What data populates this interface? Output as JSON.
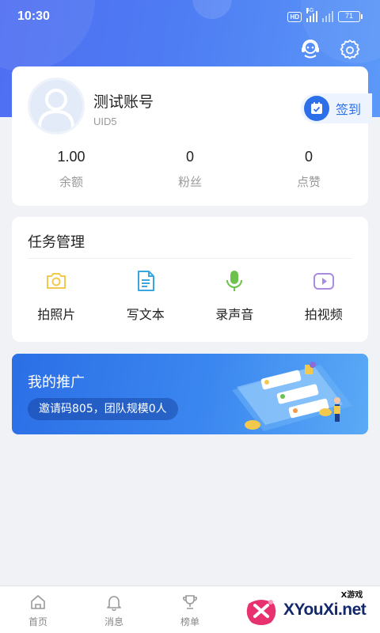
{
  "status_bar": {
    "time": "10:30",
    "hd": "HD",
    "network": "4G",
    "battery": "71"
  },
  "profile": {
    "name": "测试账号",
    "uid": "UID5",
    "checkin_label": "签到",
    "stats": [
      {
        "value": "1.00",
        "label": "余额"
      },
      {
        "value": "0",
        "label": "粉丝"
      },
      {
        "value": "0",
        "label": "点赞"
      }
    ]
  },
  "tasks": {
    "title": "任务管理",
    "items": [
      {
        "label": "拍照片",
        "icon": "camera-icon",
        "color": "#f2c94c"
      },
      {
        "label": "写文本",
        "icon": "document-icon",
        "color": "#3aa6e0"
      },
      {
        "label": "录声音",
        "icon": "microphone-icon",
        "color": "#6cc24a"
      },
      {
        "label": "拍视频",
        "icon": "video-icon",
        "color": "#a98be0"
      }
    ]
  },
  "promo": {
    "title": "我的推广",
    "invite_text": "邀请码805，团队规模0人"
  },
  "tabbar": {
    "items": [
      {
        "label": "首页",
        "icon": "home-icon"
      },
      {
        "label": "消息",
        "icon": "bell-icon"
      },
      {
        "label": "榜单",
        "icon": "trophy-icon"
      }
    ]
  },
  "watermark": {
    "small": "X游戏",
    "big": "XYouXi.net"
  },
  "colors": {
    "header_gradient_start": "#4f6ef2",
    "header_gradient_end": "#5c99f8",
    "accent": "#2c6fe8",
    "background": "#f1f2f5"
  }
}
